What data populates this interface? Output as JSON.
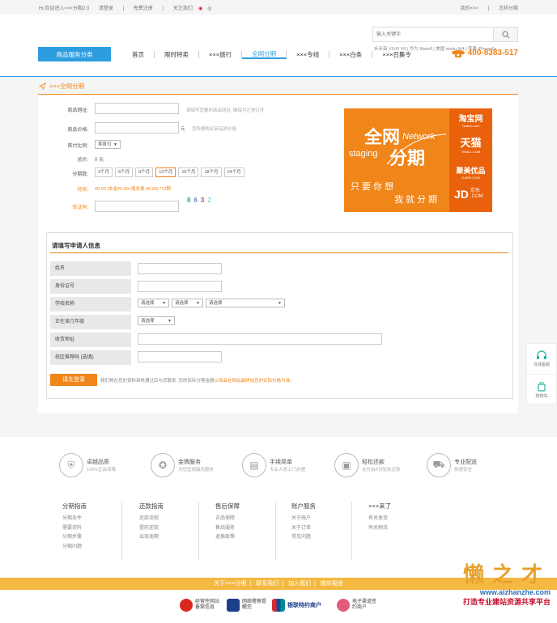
{
  "topbar": {
    "welcome": "Hi,欢迎进入×××分期2.0",
    "login": "请登录",
    "register": "免费注册",
    "follow": "关注我们:",
    "my_account": "我的×××",
    "how_to_pay": "怎样分期"
  },
  "search": {
    "placeholder": "输入关键字",
    "hotwords": "步步高 VIVO X6 | 华为 Mate8 | 美图 meitu M4 | 苹果 iPhone6s"
  },
  "nav": {
    "category": "商品服务分类",
    "items": [
      "首页",
      "限时特卖",
      "×××旅行",
      "全网分期",
      "×××专线",
      "×××白条",
      "×××召集令"
    ],
    "active_index": 3,
    "phone": "400-8383-517"
  },
  "breadcrumb": "×××全网分期",
  "form": {
    "url_label": "商品网址:",
    "url_hint": "请填写您要的商品网址, 确保可正常打开",
    "price_label": "商品价格:",
    "price_unit": "元",
    "price_hint": "您所想购买商品原价格",
    "down_label": "首付比例:",
    "down_value": "零首付",
    "total_label": "总价:",
    "total_value": "0 元",
    "period_label": "分期数:",
    "periods": [
      "3个月",
      "6个月",
      "9个月",
      "12个月",
      "15个月",
      "18个月",
      "24个月"
    ],
    "selected_period": 3,
    "monthly_label": "月供:",
    "monthly_value": "¥0.00 (本金¥0.00+服务费 ¥0.00) *12期",
    "captcha_label": "验证码:",
    "captcha_chars": [
      "8",
      "6",
      "3",
      "2"
    ]
  },
  "banner": {
    "line1": "全网",
    "network": "Network",
    "staging": "staging",
    "line2": "分期",
    "slogan1": "只要你想",
    "slogan2": "我就分期",
    "taobao": "淘宝网",
    "taobao_sub": "Taobao.com",
    "tmall": "天猫",
    "tmall_sub": "TMALL.COM",
    "jumei": "聚美优品",
    "jumei_sub": "JUMEI.COM",
    "jd": "JD",
    "jd_sub": "京东",
    "jd_com": ".COM"
  },
  "applicant": {
    "title": "请填写申请人信息",
    "rows": [
      "姓名",
      "身份证号",
      "学校名称",
      "正在读几年级",
      "收货地址",
      "校区推荐码 (选填)"
    ],
    "select_text": "请选择",
    "submit": "请先登录",
    "tip_prefix": "我们将在您的资料审核通过后与您联系, 您的实际分期金额",
    "tip_link": "以商品在网站最终给您的实际价格为准",
    "tip_suffix": "。"
  },
  "side": {
    "service": "在线客服",
    "cart": "购物车"
  },
  "features": [
    {
      "title": "卓越品质",
      "sub": "100%正品保障",
      "icon": "shield-icon"
    },
    {
      "title": "金牌服务",
      "sub": "为您呈现最优服务",
      "icon": "medal-icon"
    },
    {
      "title": "手续简单",
      "sub": "专业人员上门办理",
      "icon": "document-icon"
    },
    {
      "title": "轻松还款",
      "sub": "支付由P对轻松还款",
      "icon": "wallet-icon"
    },
    {
      "title": "专业配送",
      "sub": "快速安全",
      "icon": "truck-icon"
    }
  ],
  "footer_cols": [
    {
      "head": "分期指南",
      "links": [
        "分期条件",
        "需要资料",
        "分期步骤",
        "分期问题"
      ]
    },
    {
      "head": "还款指南",
      "links": [
        "还款流程",
        "提前还款",
        "出现逾期"
      ]
    },
    {
      "head": "售后保障",
      "links": [
        "正品保障",
        "售后服务",
        "退换政策"
      ]
    },
    {
      "head": "账户服务",
      "links": [
        "关于账户",
        "关于订单",
        "常见问题"
      ]
    },
    {
      "head": "×××来了",
      "links": [
        "有关发货",
        "有关物流"
      ]
    }
  ],
  "bottom_links": [
    "关于×××分期",
    "联系我们",
    "加入我们",
    "媒体报道"
  ],
  "badges": [
    "经营性网站备案信息",
    "网络警察提醒您",
    "银联特约商户",
    "电子渠道签约商户"
  ],
  "watermark": {
    "big": "懒之才",
    "url": "www.aizhanzhe.com",
    "slogan": "打造专业建站资源共享平台"
  },
  "colors": {
    "accent_blue": "#2d9de0",
    "accent_orange": "#f08519"
  }
}
